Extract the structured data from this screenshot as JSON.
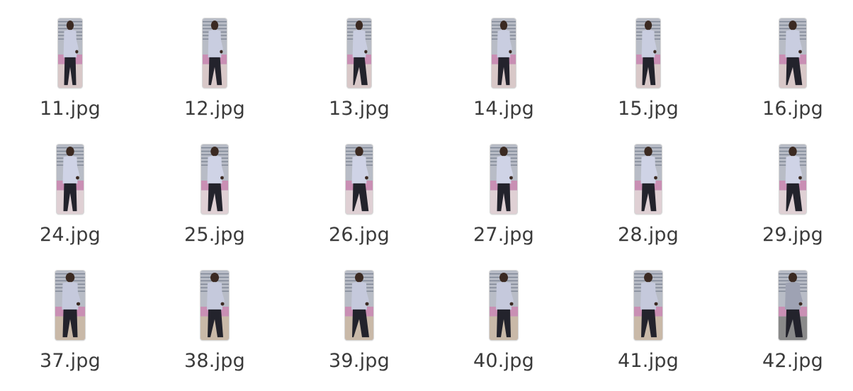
{
  "files": [
    {
      "name": "11.jpg",
      "tint": "#d8c8c8",
      "shirt": "#c9cde0"
    },
    {
      "name": "12.jpg",
      "tint": "#d8c8c8",
      "shirt": "#c9cde0"
    },
    {
      "name": "13.jpg",
      "tint": "#d8c8c8",
      "shirt": "#c9cde0"
    },
    {
      "name": "14.jpg",
      "tint": "#d8c8c8",
      "shirt": "#c9cde0"
    },
    {
      "name": "15.jpg",
      "tint": "#d8c8c8",
      "shirt": "#c9cde0"
    },
    {
      "name": "16.jpg",
      "tint": "#d8c8c8",
      "shirt": "#c9cde0"
    },
    {
      "name": "24.jpg",
      "tint": "#dfd0d4",
      "shirt": "#cfd3e6"
    },
    {
      "name": "25.jpg",
      "tint": "#dfd0d4",
      "shirt": "#cfd3e6"
    },
    {
      "name": "26.jpg",
      "tint": "#dfd0d4",
      "shirt": "#cfd3e6"
    },
    {
      "name": "27.jpg",
      "tint": "#dfd0d4",
      "shirt": "#cfd3e6"
    },
    {
      "name": "28.jpg",
      "tint": "#dfd0d4",
      "shirt": "#cfd3e6"
    },
    {
      "name": "29.jpg",
      "tint": "#dfd0d4",
      "shirt": "#cfd3e6"
    },
    {
      "name": "37.jpg",
      "tint": "#c9b9a8",
      "shirt": "#c5c9dc"
    },
    {
      "name": "38.jpg",
      "tint": "#c9b9a8",
      "shirt": "#c5c9dc"
    },
    {
      "name": "39.jpg",
      "tint": "#c9b9a8",
      "shirt": "#c5c9dc"
    },
    {
      "name": "40.jpg",
      "tint": "#c9b9a8",
      "shirt": "#c5c9dc"
    },
    {
      "name": "41.jpg",
      "tint": "#c9b9a8",
      "shirt": "#c5c9dc"
    },
    {
      "name": "42.jpg",
      "tint": "#8a8a8a",
      "shirt": "#9ea2b3"
    }
  ]
}
